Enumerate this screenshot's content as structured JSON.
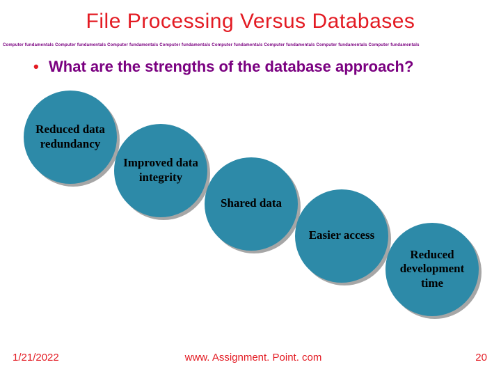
{
  "title": "File Processing Versus Databases",
  "banner_unit": "Computer fundamentals",
  "banner_repeat": 8,
  "question": "What are the strengths of the database approach?",
  "bubbles": {
    "b1": "Reduced data redundancy",
    "b2": "Improved data integrity",
    "b3": "Shared data",
    "b4": "Easier access",
    "b5": "Reduced development time"
  },
  "footer": {
    "date": "1/21/2022",
    "url": "www. Assignment. Point. com",
    "page": "20"
  }
}
